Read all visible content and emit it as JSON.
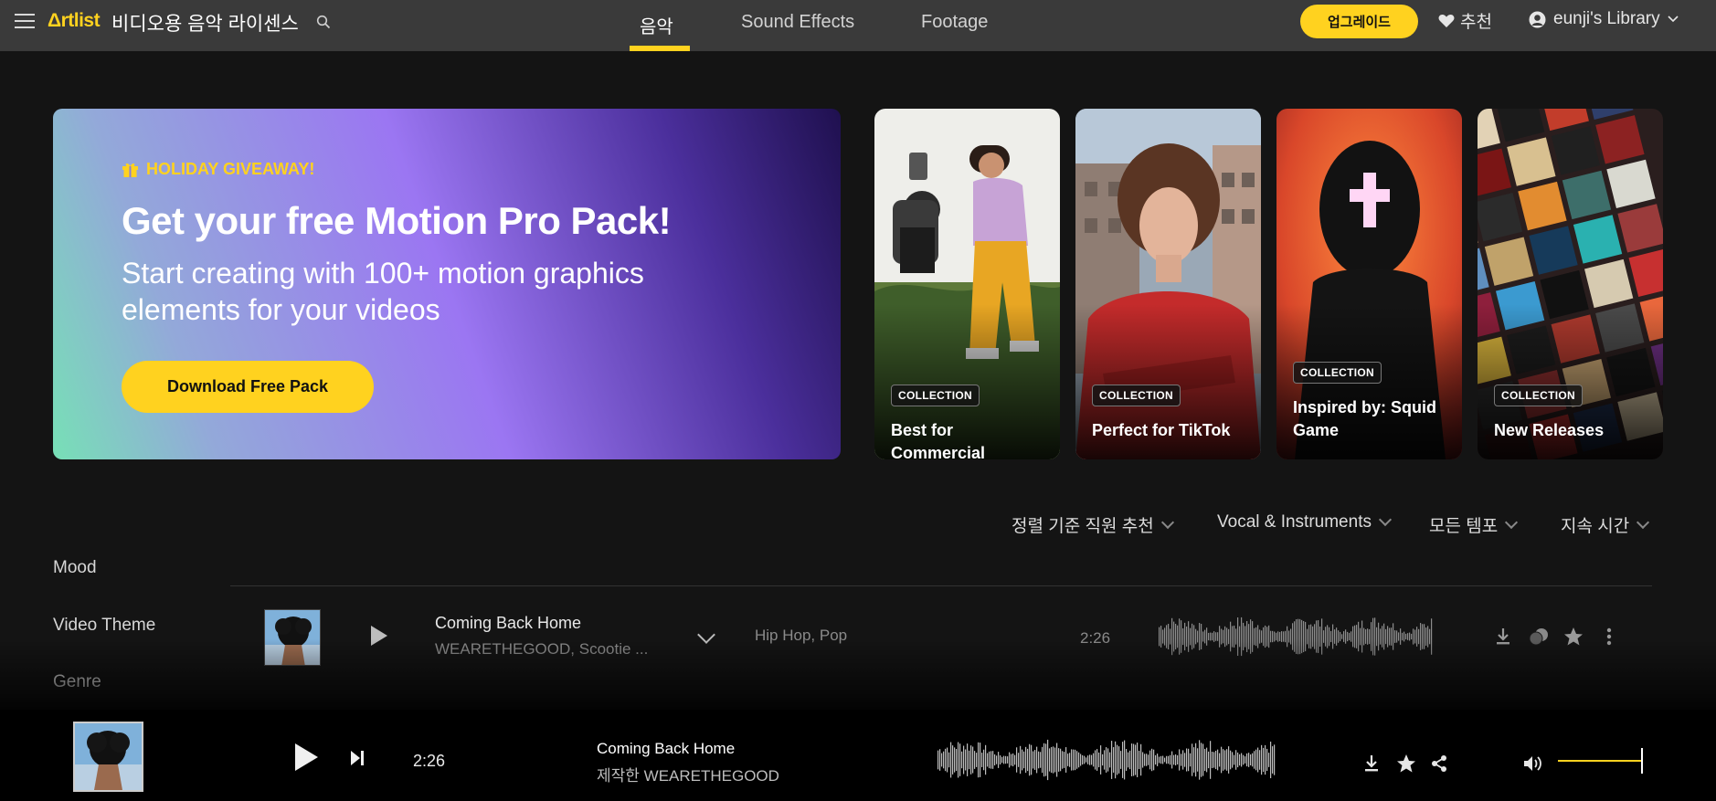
{
  "header": {
    "logo": "Δrtlist",
    "site_title": "비디오용 음악 라이센스",
    "tabs": [
      {
        "label": "음악",
        "active": true
      },
      {
        "label": "Sound Effects",
        "active": false
      },
      {
        "label": "Footage",
        "active": false
      }
    ],
    "upgrade_label": "업그레이드",
    "recommend_label": "추천",
    "library_label": "eunji's Library"
  },
  "hero": {
    "tag": "HOLIDAY GIVEAWAY!",
    "title": "Get your free Motion Pro Pack!",
    "subtitle": "Start creating with 100+ motion graphics elements for your videos",
    "button_label": "Download Free Pack"
  },
  "collections": [
    {
      "badge": "COLLECTION",
      "title": "Best for Commercial"
    },
    {
      "badge": "COLLECTION",
      "title": "Perfect for TikTok"
    },
    {
      "badge": "COLLECTION",
      "title": "Inspired by: Squid Game"
    },
    {
      "badge": "COLLECTION",
      "title": "New Releases"
    }
  ],
  "filters": {
    "sort": "정렬 기준 직원 추천",
    "vocal": "Vocal & Instruments",
    "tempo": "모든 템포",
    "duration": "지속 시간"
  },
  "sidebar": {
    "items": [
      "Mood",
      "Video Theme",
      "Genre"
    ]
  },
  "tracks": [
    {
      "title": "Coming Back Home",
      "artist": "WEARETHEGOOD, Scootie ...",
      "genres": "Hip Hop,  Pop",
      "duration": "2:26"
    }
  ],
  "player": {
    "time": "2:26",
    "title": "Coming Back Home",
    "artist": "제작한 WEARETHEGOOD",
    "volume": 0.82
  },
  "colors": {
    "accent": "#ffd21f",
    "topbar": "#3a3a3a",
    "background": "#141414"
  }
}
